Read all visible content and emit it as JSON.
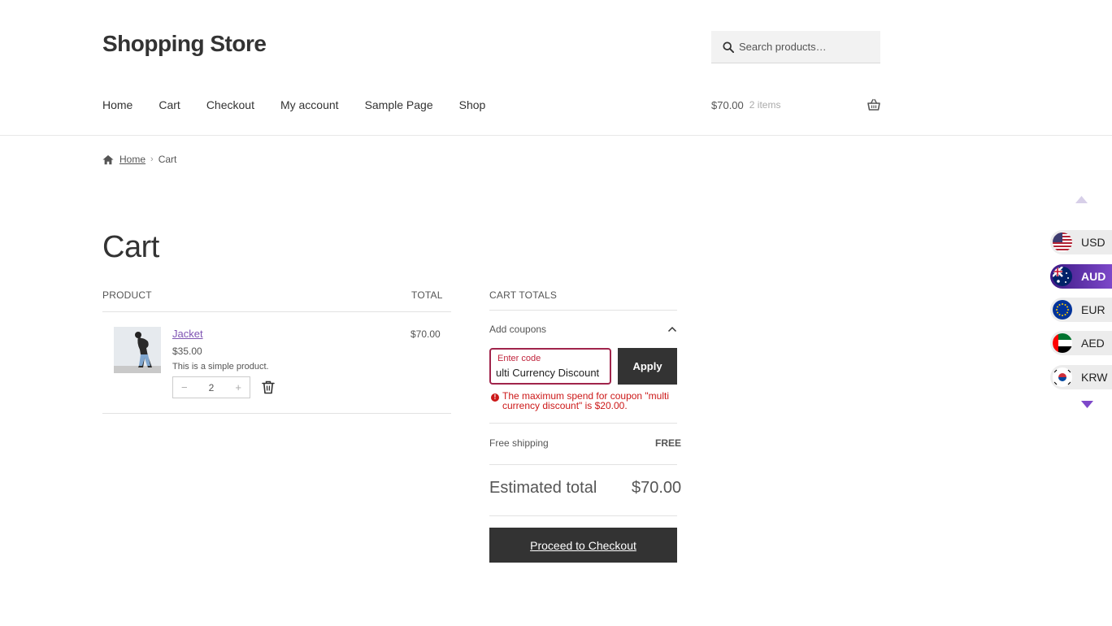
{
  "header": {
    "site_title": "Shopping Store",
    "search_placeholder": "Search products…",
    "nav": [
      "Home",
      "Cart",
      "Checkout",
      "My account",
      "Sample Page",
      "Shop"
    ],
    "mini_cart": {
      "amount": "$70.00",
      "count": "2 items"
    }
  },
  "breadcrumb": {
    "home": "Home",
    "current": "Cart"
  },
  "page_title": "Cart",
  "cart_table": {
    "col_product": "PRODUCT",
    "col_total": "TOTAL",
    "items": [
      {
        "name": "Jacket",
        "price": "$35.00",
        "description": "This is a simple product.",
        "quantity": "2",
        "qty_minus": "−",
        "qty_plus": "+",
        "line_total": "$70.00"
      }
    ]
  },
  "cart_totals": {
    "heading": "CART TOTALS",
    "add_coupons": "Add coupons",
    "code_label": "Enter code",
    "code_value": "ulti Currency Discount",
    "apply": "Apply",
    "error": "The maximum spend for coupon \"multi currency discount\" is $20.00.",
    "shipping_label": "Free shipping",
    "shipping_value": "FREE",
    "estimated_label": "Estimated total",
    "estimated_value": "$70.00",
    "checkout_button": "Proceed to Checkout"
  },
  "currency_switcher": {
    "items": [
      {
        "code": "USD",
        "active": false
      },
      {
        "code": "AUD",
        "active": true
      },
      {
        "code": "EUR",
        "active": false
      },
      {
        "code": "AED",
        "active": false
      },
      {
        "code": "KRW",
        "active": false
      }
    ],
    "active_color": "#5b2fa8"
  },
  "colors": {
    "accent": "#7f54b3",
    "error": "#cc1818",
    "dark_button": "#333333"
  }
}
